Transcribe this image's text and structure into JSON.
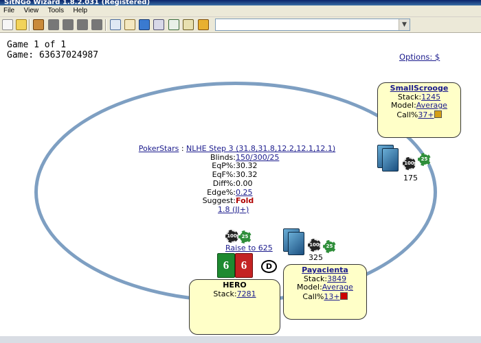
{
  "window": {
    "title": "SitNGo Wizard 1.8.2.031 (Registered)"
  },
  "menu": [
    "File",
    "View",
    "Tools",
    "Help"
  ],
  "toolbar": {
    "combo_value": ""
  },
  "game": {
    "game_counter": "Game 1 of 1",
    "game_id": "Game: 63637024987"
  },
  "options_link": "Options: $",
  "info": {
    "site": "PokerStars",
    "separator": " : ",
    "structure": "NLHE Step 3 (31.8,31.8,12.2,12.1,12.1)",
    "blinds_label": "Blinds: ",
    "blinds_value": "150/300/25",
    "eqp_label": "EqP%: ",
    "eqp_value": "30.32",
    "eqf_label": "EqF%: ",
    "eqf_value": "30.32",
    "diff_label": "Diff%: ",
    "diff_value": "0.00",
    "edge_label": "Edge%: ",
    "edge_value": "0.25",
    "suggest_label": "Suggest: ",
    "suggest_value": "Fold",
    "range": "1.8 (JJ+)"
  },
  "players": {
    "small_scrooge": {
      "name": "SmallScrooge",
      "stack_label": "Stack:",
      "stack_value": "1245",
      "model_label": "Model:",
      "model_value": "Average",
      "call_label": "Call%",
      "call_value": "37+",
      "call_color": "#d4a017",
      "bet": "175"
    },
    "payacienta": {
      "name": "Payacienta",
      "stack_label": "Stack:",
      "stack_value": "3849",
      "model_label": "Model:",
      "model_value": "Average",
      "call_label": "Call%",
      "call_value": "13+",
      "call_color": "#cc0000",
      "bet": "325"
    },
    "hero": {
      "name": "HERO",
      "stack_label": "Stack:",
      "stack_value": "7281",
      "action": "Raise to 625",
      "cards": [
        "6",
        "6"
      ]
    }
  },
  "chips": {
    "c100": "100",
    "c25": "25"
  },
  "dealer_button": "D",
  "colors": {
    "table_rail": "#7e9fc2",
    "player_box": "#ffffc8",
    "link": "#1a1a8c",
    "fold": "#b00000"
  }
}
